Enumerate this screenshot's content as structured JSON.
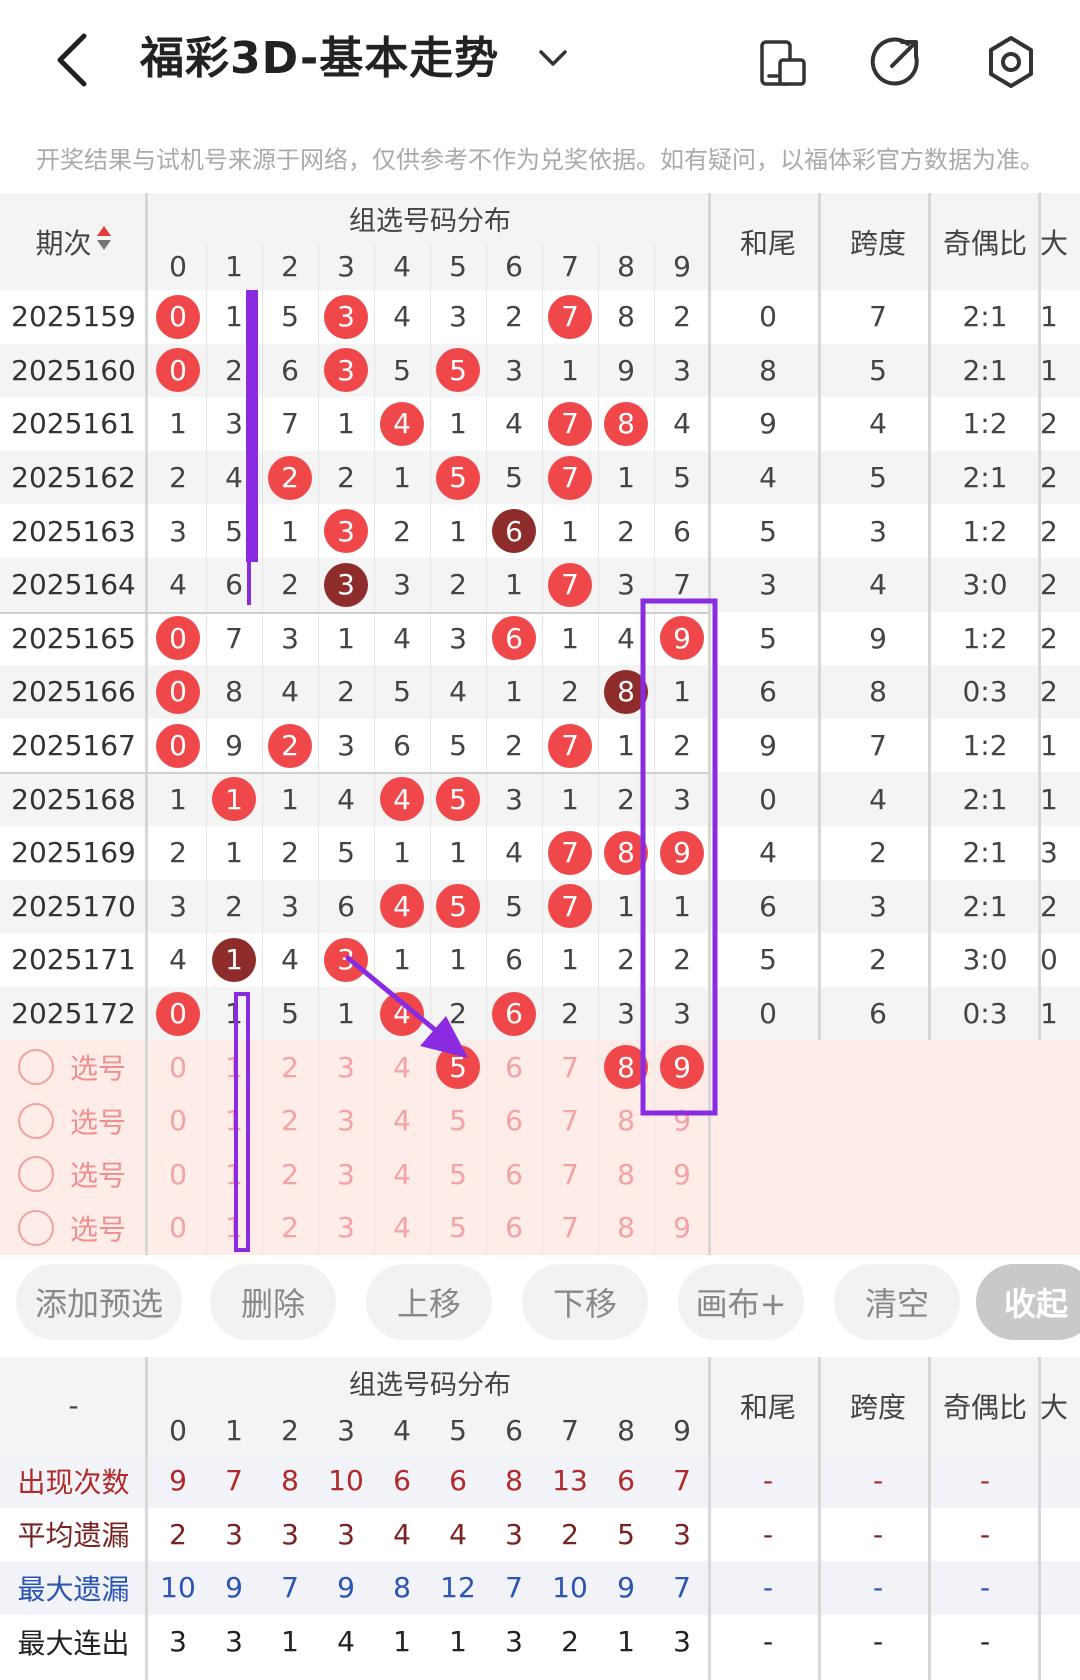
{
  "header": {
    "title": "福彩3D-基本走势"
  },
  "notice": "开奖结果与试机号来源于网络，仅供参考不作为兑奖依据。如有疑问，以福体彩官方数据为准。",
  "table": {
    "col_period": "期次",
    "group_header": "组选号码分布",
    "digits": [
      "0",
      "1",
      "2",
      "3",
      "4",
      "5",
      "6",
      "7",
      "8",
      "9"
    ],
    "extra_headers": [
      "和尾",
      "跨度",
      "奇偶比",
      "大"
    ],
    "rows": [
      {
        "period": "2025159",
        "cells": [
          "0",
          "1",
          "5",
          "3",
          "4",
          "3",
          "2",
          "7",
          "8",
          "2"
        ],
        "hits": [
          0,
          3,
          7
        ],
        "dark": [],
        "he": "0",
        "kd": "7",
        "oe": "2:1",
        "big": "1"
      },
      {
        "period": "2025160",
        "cells": [
          "0",
          "2",
          "6",
          "3",
          "5",
          "5",
          "3",
          "1",
          "9",
          "3"
        ],
        "hits": [
          0,
          3,
          5
        ],
        "dark": [],
        "he": "8",
        "kd": "5",
        "oe": "2:1",
        "big": "1"
      },
      {
        "period": "2025161",
        "cells": [
          "1",
          "3",
          "7",
          "1",
          "4",
          "1",
          "4",
          "7",
          "8",
          "4"
        ],
        "hits": [
          4,
          7,
          8
        ],
        "dark": [],
        "he": "9",
        "kd": "4",
        "oe": "1:2",
        "big": "2"
      },
      {
        "period": "2025162",
        "cells": [
          "2",
          "4",
          "2",
          "2",
          "1",
          "5",
          "5",
          "7",
          "1",
          "5"
        ],
        "hits": [
          2,
          5,
          7
        ],
        "dark": [],
        "he": "4",
        "kd": "5",
        "oe": "2:1",
        "big": "2"
      },
      {
        "period": "2025163",
        "cells": [
          "3",
          "5",
          "1",
          "3",
          "2",
          "1",
          "6",
          "1",
          "2",
          "6"
        ],
        "hits": [
          3
        ],
        "dark": [
          6
        ],
        "he": "5",
        "kd": "3",
        "oe": "1:2",
        "big": "2"
      },
      {
        "period": "2025164",
        "cells": [
          "4",
          "6",
          "2",
          "3",
          "3",
          "2",
          "1",
          "7",
          "3",
          "7"
        ],
        "hits": [
          7
        ],
        "dark": [
          3
        ],
        "he": "3",
        "kd": "4",
        "oe": "3:0",
        "big": "2"
      },
      {
        "period": "2025165",
        "cells": [
          "0",
          "7",
          "3",
          "1",
          "4",
          "3",
          "6",
          "1",
          "4",
          "9"
        ],
        "hits": [
          0,
          6,
          9
        ],
        "dark": [],
        "he": "5",
        "kd": "9",
        "oe": "1:2",
        "big": "2"
      },
      {
        "period": "2025166",
        "cells": [
          "0",
          "8",
          "4",
          "2",
          "5",
          "4",
          "1",
          "2",
          "8",
          "1"
        ],
        "hits": [
          0
        ],
        "dark": [
          8
        ],
        "he": "6",
        "kd": "8",
        "oe": "0:3",
        "big": "2"
      },
      {
        "period": "2025167",
        "cells": [
          "0",
          "9",
          "2",
          "3",
          "6",
          "5",
          "2",
          "7",
          "1",
          "2"
        ],
        "hits": [
          0,
          2,
          7
        ],
        "dark": [],
        "he": "9",
        "kd": "7",
        "oe": "1:2",
        "big": "1"
      },
      {
        "period": "2025168",
        "cells": [
          "1",
          "1",
          "1",
          "4",
          "4",
          "5",
          "3",
          "1",
          "2",
          "3"
        ],
        "hits": [
          1,
          4,
          5
        ],
        "dark": [],
        "he": "0",
        "kd": "4",
        "oe": "2:1",
        "big": "1"
      },
      {
        "period": "2025169",
        "cells": [
          "2",
          "1",
          "2",
          "5",
          "1",
          "1",
          "4",
          "7",
          "8",
          "9"
        ],
        "hits": [
          7,
          8,
          9
        ],
        "dark": [],
        "he": "4",
        "kd": "2",
        "oe": "2:1",
        "big": "3"
      },
      {
        "period": "2025170",
        "cells": [
          "3",
          "2",
          "3",
          "6",
          "4",
          "5",
          "5",
          "7",
          "1",
          "1"
        ],
        "hits": [
          4,
          5,
          7
        ],
        "dark": [],
        "he": "6",
        "kd": "3",
        "oe": "2:1",
        "big": "2"
      },
      {
        "period": "2025171",
        "cells": [
          "4",
          "1",
          "4",
          "3",
          "1",
          "1",
          "6",
          "1",
          "2",
          "2"
        ],
        "hits": [
          3
        ],
        "dark": [
          1
        ],
        "he": "5",
        "kd": "2",
        "oe": "3:0",
        "big": "0"
      },
      {
        "period": "2025172",
        "cells": [
          "0",
          "1",
          "5",
          "1",
          "4",
          "2",
          "6",
          "2",
          "3",
          "3"
        ],
        "hits": [
          0,
          4,
          6
        ],
        "dark": [],
        "he": "0",
        "kd": "6",
        "oe": "0:3",
        "big": "1"
      }
    ],
    "select_rows": [
      {
        "label": "选号",
        "hits": [
          5,
          8,
          9
        ]
      },
      {
        "label": "选号",
        "hits": []
      },
      {
        "label": "选号",
        "hits": []
      },
      {
        "label": "选号",
        "hits": []
      }
    ]
  },
  "buttons": [
    "添加预选",
    "删除",
    "上移",
    "下移",
    "画布+",
    "清空",
    "收起"
  ],
  "stats": {
    "corner": "-",
    "group_header": "组选号码分布",
    "rows": [
      {
        "label": "出现次数",
        "values": [
          "9",
          "7",
          "8",
          "10",
          "6",
          "6",
          "8",
          "13",
          "6",
          "7"
        ],
        "extras": [
          "-",
          "-",
          "-"
        ],
        "color": "#b02a2a"
      },
      {
        "label": "平均遗漏",
        "values": [
          "2",
          "3",
          "3",
          "3",
          "4",
          "4",
          "3",
          "2",
          "5",
          "3"
        ],
        "extras": [
          "-",
          "-",
          "-"
        ],
        "color": "#7a2222"
      },
      {
        "label": "最大遗漏",
        "values": [
          "10",
          "9",
          "7",
          "9",
          "8",
          "12",
          "7",
          "10",
          "9",
          "7"
        ],
        "extras": [
          "-",
          "-",
          "-"
        ],
        "color": "#2b54b3"
      },
      {
        "label": "最大连出",
        "values": [
          "3",
          "3",
          "1",
          "4",
          "1",
          "1",
          "3",
          "2",
          "1",
          "3"
        ],
        "extras": [
          "-",
          "-",
          "-"
        ],
        "color": "#222"
      }
    ]
  },
  "colors": {
    "hit": "#f0484a",
    "dark_hit": "#8e2b2b",
    "annotation": "#8a2be2",
    "select_bg": "#fdece8"
  }
}
